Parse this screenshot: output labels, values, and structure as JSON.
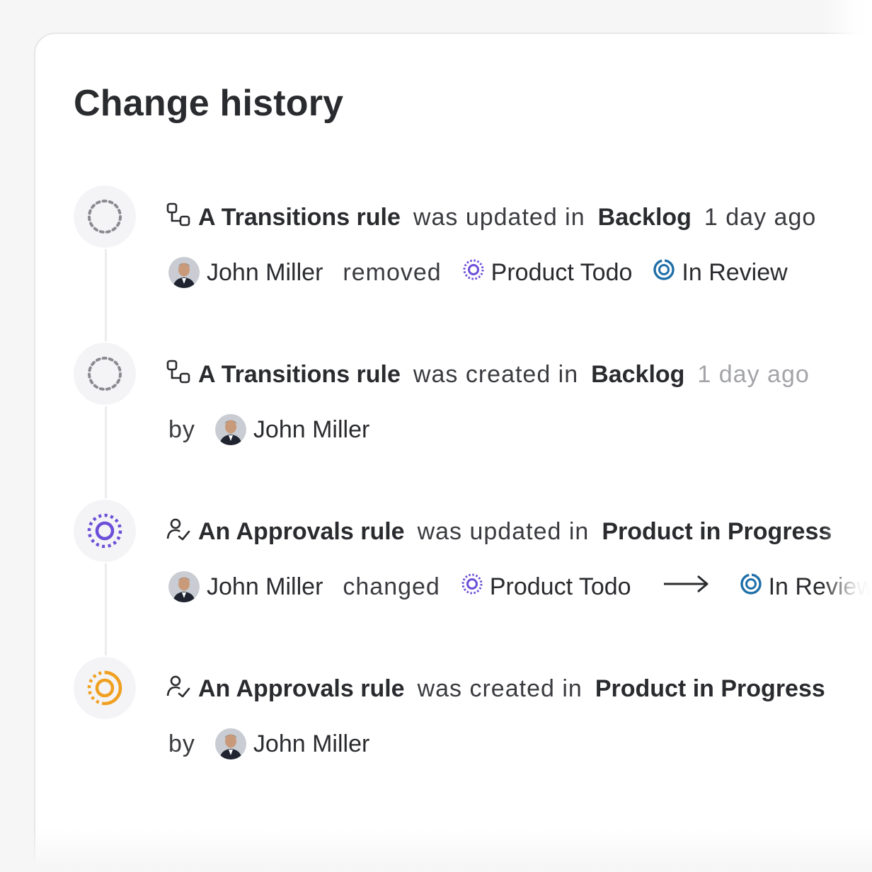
{
  "page": {
    "title": "Change history"
  },
  "entries": [
    {
      "line1": {
        "rule": "A Transitions rule",
        "action": "was updated in",
        "board": "Backlog",
        "time": "1 day ago"
      },
      "line2": {
        "user": "John Miller",
        "verb": "removed",
        "from_status": "Product Todo",
        "to_status": "In Review"
      },
      "node_icon": "dotted-spinner-gray",
      "rule_icon": "transitions-icon"
    },
    {
      "line1": {
        "rule": "A Transitions rule",
        "action": "was created in",
        "board": "Backlog",
        "time": "1 day ago"
      },
      "line2": {
        "by": "by",
        "user": "John Miller"
      },
      "node_icon": "dotted-spinner-gray",
      "rule_icon": "transitions-icon"
    },
    {
      "line1": {
        "rule": "An Approvals rule",
        "action": "was updated in",
        "board": "Product in Progress"
      },
      "line2": {
        "user": "John Miller",
        "verb": "changed",
        "from_status": "Product Todo",
        "to_status": "In Review"
      },
      "node_icon": "ring-purple",
      "rule_icon": "approvals-icon"
    },
    {
      "line1": {
        "rule": "An Approvals rule",
        "action": "was created in",
        "board": "Product in Progress"
      },
      "line2": {
        "by": "by",
        "user": "John Miller"
      },
      "node_icon": "ring-orange",
      "rule_icon": "approvals-icon"
    }
  ],
  "colors": {
    "purple": "#6c4fd8",
    "blue": "#1f6fa8",
    "orange": "#f0a020",
    "gray": "#8a8b90"
  }
}
